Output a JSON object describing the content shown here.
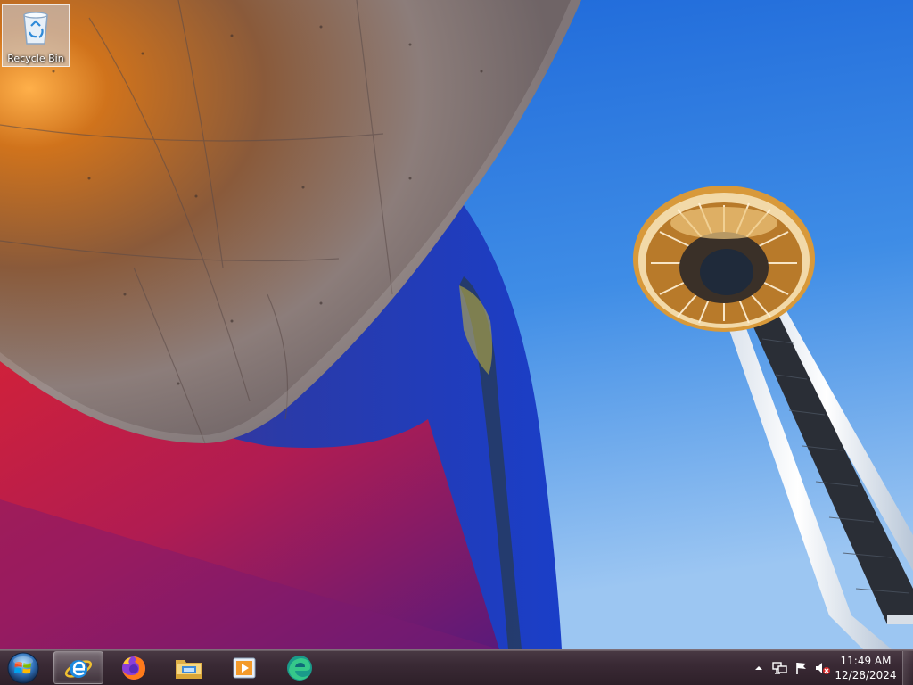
{
  "desktop": {
    "icons": [
      {
        "label": "Recycle Bin",
        "icon": "recycle-bin-icon"
      }
    ]
  },
  "taskbar": {
    "start": {
      "icon": "windows-orb-icon"
    },
    "pinned": [
      {
        "icon": "internet-explorer-icon",
        "active": true
      },
      {
        "icon": "firefox-icon",
        "active": false
      },
      {
        "icon": "windows-explorer-icon",
        "active": false
      },
      {
        "icon": "media-player-icon",
        "active": false
      },
      {
        "icon": "edge-icon",
        "active": false
      }
    ],
    "tray": {
      "icons": [
        "show-hidden-icons-arrow-icon",
        "network-icon",
        "action-center-flag-icon",
        "volume-muted-icon"
      ],
      "time": "11:49 AM",
      "date": "12/28/2024"
    }
  },
  "colors": {
    "taskbar": "#3a2a35",
    "sky": "#2a6fd0",
    "tower": "#e8eef5",
    "saucer_rim": "#d8993a"
  }
}
